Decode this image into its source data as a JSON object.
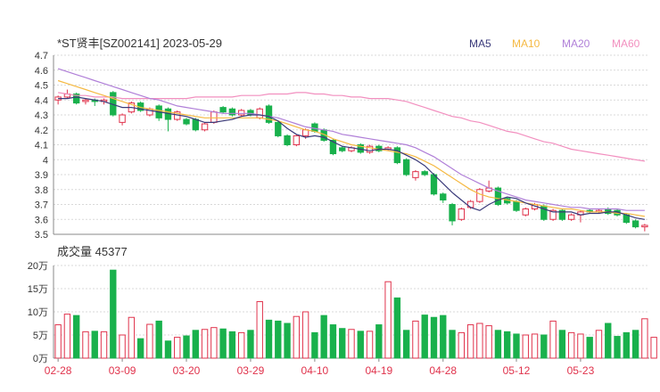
{
  "header": {
    "title": "*ST贤丰[SZ002141] 2023-05-29",
    "legend": [
      {
        "label": "MA5",
        "color": "#3a3a7a"
      },
      {
        "label": "MA10",
        "color": "#f5b942"
      },
      {
        "label": "MA20",
        "color": "#b07fd8"
      },
      {
        "label": "MA60",
        "color": "#f28fbf"
      }
    ]
  },
  "colors": {
    "up": "#e0334c",
    "down": "#19b14c",
    "grid": "#d9d9d9",
    "axis": "#333333"
  },
  "chart_data": [
    {
      "type": "candlestick",
      "ylim": [
        3.5,
        4.7
      ],
      "yticks": [
        "3.5",
        "3.6",
        "3.7",
        "3.8",
        "3.9",
        "4",
        "4.1",
        "4.2",
        "4.3",
        "4.4",
        "4.5",
        "4.6",
        "4.7"
      ],
      "candles": [
        [
          4.4,
          4.42,
          4.43,
          4.37
        ],
        [
          4.42,
          4.44,
          4.47,
          4.41
        ],
        [
          4.44,
          4.38,
          4.45,
          4.37
        ],
        [
          4.39,
          4.4,
          4.41,
          4.37
        ],
        [
          4.4,
          4.39,
          4.41,
          4.36
        ],
        [
          4.39,
          4.4,
          4.41,
          4.37
        ],
        [
          4.45,
          4.3,
          4.46,
          4.29
        ],
        [
          4.25,
          4.3,
          4.31,
          4.23
        ],
        [
          4.32,
          4.38,
          4.39,
          4.31
        ],
        [
          4.38,
          4.33,
          4.39,
          4.32
        ],
        [
          4.3,
          4.34,
          4.35,
          4.29
        ],
        [
          4.36,
          4.28,
          4.37,
          4.26
        ],
        [
          4.34,
          4.27,
          4.35,
          4.19
        ],
        [
          4.27,
          4.32,
          4.33,
          4.26
        ],
        [
          4.27,
          4.24,
          4.28,
          4.23
        ],
        [
          4.27,
          4.2,
          4.28,
          4.19
        ],
        [
          4.2,
          4.24,
          4.25,
          4.19
        ],
        [
          4.25,
          4.32,
          4.33,
          4.24
        ],
        [
          4.35,
          4.32,
          4.36,
          4.31
        ],
        [
          4.34,
          4.3,
          4.35,
          4.29
        ],
        [
          4.3,
          4.33,
          4.34,
          4.29
        ],
        [
          4.33,
          4.3,
          4.34,
          4.29
        ],
        [
          4.28,
          4.34,
          4.35,
          4.27
        ],
        [
          4.36,
          4.25,
          4.37,
          4.24
        ],
        [
          4.25,
          4.16,
          4.26,
          4.15
        ],
        [
          4.16,
          4.1,
          4.17,
          4.09
        ],
        [
          4.1,
          4.16,
          4.17,
          4.09
        ],
        [
          4.16,
          4.2,
          4.21,
          4.14
        ],
        [
          4.24,
          4.19,
          4.25,
          4.18
        ],
        [
          4.2,
          4.13,
          4.21,
          4.12
        ],
        [
          4.13,
          4.04,
          4.14,
          4.03
        ],
        [
          4.08,
          4.06,
          4.09,
          4.05
        ],
        [
          4.06,
          4.08,
          4.09,
          4.05
        ],
        [
          4.1,
          4.05,
          4.11,
          4.04
        ],
        [
          4.05,
          4.09,
          4.1,
          4.04
        ],
        [
          4.09,
          4.06,
          4.1,
          4.05
        ],
        [
          4.07,
          4.08,
          4.09,
          4.06
        ],
        [
          4.08,
          3.98,
          4.09,
          3.97
        ],
        [
          4.0,
          3.9,
          4.01,
          3.89
        ],
        [
          3.88,
          3.92,
          3.93,
          3.86
        ],
        [
          3.92,
          3.9,
          3.93,
          3.89
        ],
        [
          3.9,
          3.77,
          3.91,
          3.76
        ],
        [
          3.77,
          3.73,
          3.78,
          3.71
        ],
        [
          3.7,
          3.59,
          3.71,
          3.56
        ],
        [
          3.6,
          3.67,
          3.68,
          3.59
        ],
        [
          3.68,
          3.72,
          3.73,
          3.67
        ],
        [
          3.72,
          3.8,
          3.81,
          3.71
        ],
        [
          3.79,
          3.81,
          3.86,
          3.78
        ],
        [
          3.81,
          3.7,
          3.82,
          3.69
        ],
        [
          3.74,
          3.71,
          3.75,
          3.7
        ],
        [
          3.72,
          3.66,
          3.73,
          3.65
        ],
        [
          3.63,
          3.67,
          3.68,
          3.62
        ],
        [
          3.67,
          3.7,
          3.71,
          3.66
        ],
        [
          3.69,
          3.6,
          3.7,
          3.59
        ],
        [
          3.6,
          3.66,
          3.67,
          3.59
        ],
        [
          3.66,
          3.6,
          3.67,
          3.59
        ],
        [
          3.6,
          3.63,
          3.64,
          3.59
        ],
        [
          3.63,
          3.65,
          3.66,
          3.58
        ],
        [
          3.66,
          3.65,
          3.67,
          3.64
        ],
        [
          3.65,
          3.66,
          3.67,
          3.64
        ],
        [
          3.67,
          3.64,
          3.68,
          3.63
        ],
        [
          3.66,
          3.63,
          3.67,
          3.62
        ],
        [
          3.63,
          3.58,
          3.64,
          3.57
        ],
        [
          3.59,
          3.55,
          3.6,
          3.54
        ],
        [
          3.55,
          3.56,
          3.57,
          3.52
        ]
      ],
      "ma5": [
        4.41,
        4.41,
        4.42,
        4.41,
        4.4,
        4.39,
        4.37,
        4.35,
        4.35,
        4.34,
        4.33,
        4.32,
        4.31,
        4.3,
        4.29,
        4.27,
        4.25,
        4.25,
        4.26,
        4.27,
        4.29,
        4.3,
        4.3,
        4.29,
        4.26,
        4.21,
        4.17,
        4.15,
        4.16,
        4.15,
        4.12,
        4.09,
        4.08,
        4.07,
        4.06,
        4.07,
        4.07,
        4.06,
        4.03,
        4.0,
        3.96,
        3.9,
        3.84,
        3.78,
        3.73,
        3.68,
        3.66,
        3.7,
        3.73,
        3.75,
        3.74,
        3.71,
        3.69,
        3.67,
        3.65,
        3.65,
        3.65,
        3.63,
        3.64,
        3.64,
        3.65,
        3.65,
        3.63,
        3.61,
        3.6
      ],
      "ma10": [
        4.53,
        4.51,
        4.49,
        4.47,
        4.45,
        4.43,
        4.41,
        4.39,
        4.37,
        4.35,
        4.34,
        4.33,
        4.32,
        4.31,
        4.3,
        4.29,
        4.28,
        4.28,
        4.28,
        4.28,
        4.28,
        4.28,
        4.28,
        4.27,
        4.26,
        4.24,
        4.22,
        4.2,
        4.19,
        4.17,
        4.14,
        4.12,
        4.1,
        4.09,
        4.08,
        4.07,
        4.06,
        4.05,
        4.04,
        4.02,
        3.99,
        3.96,
        3.92,
        3.88,
        3.84,
        3.8,
        3.77,
        3.75,
        3.74,
        3.73,
        3.72,
        3.71,
        3.7,
        3.69,
        3.68,
        3.67,
        3.67,
        3.66,
        3.65,
        3.65,
        3.65,
        3.64,
        3.64,
        3.63,
        3.62
      ],
      "ma20": [
        4.61,
        4.59,
        4.57,
        4.55,
        4.53,
        4.51,
        4.49,
        4.47,
        4.45,
        4.43,
        4.41,
        4.4,
        4.38,
        4.36,
        4.35,
        4.34,
        4.33,
        4.32,
        4.31,
        4.31,
        4.31,
        4.31,
        4.3,
        4.29,
        4.28,
        4.26,
        4.24,
        4.22,
        4.21,
        4.2,
        4.19,
        4.17,
        4.16,
        4.15,
        4.14,
        4.13,
        4.12,
        4.11,
        4.1,
        4.08,
        4.05,
        4.02,
        3.98,
        3.94,
        3.9,
        3.87,
        3.84,
        3.81,
        3.79,
        3.77,
        3.75,
        3.73,
        3.72,
        3.71,
        3.7,
        3.69,
        3.68,
        3.68,
        3.67,
        3.67,
        3.67,
        3.67,
        3.66,
        3.66,
        3.66
      ],
      "ma60": [
        4.45,
        4.44,
        4.43,
        4.43,
        4.42,
        4.42,
        4.42,
        4.41,
        4.41,
        4.41,
        4.41,
        4.41,
        4.41,
        4.41,
        4.41,
        4.42,
        4.42,
        4.42,
        4.42,
        4.42,
        4.43,
        4.43,
        4.43,
        4.44,
        4.44,
        4.44,
        4.45,
        4.45,
        4.44,
        4.44,
        4.43,
        4.43,
        4.42,
        4.42,
        4.41,
        4.41,
        4.41,
        4.4,
        4.39,
        4.37,
        4.35,
        4.33,
        4.31,
        4.29,
        4.28,
        4.26,
        4.25,
        4.23,
        4.21,
        4.19,
        4.18,
        4.16,
        4.14,
        4.12,
        4.11,
        4.09,
        4.07,
        4.06,
        4.05,
        4.04,
        4.03,
        4.02,
        4.01,
        4.0,
        3.99
      ]
    },
    {
      "type": "bar",
      "title": "成交量 45377",
      "ylim": [
        0,
        200000
      ],
      "yticks": [
        "0万",
        "5万",
        "10万",
        "15万",
        "20万"
      ],
      "volumes": [
        72000,
        95000,
        92000,
        57000,
        58000,
        57000,
        190000,
        50000,
        88000,
        42000,
        73000,
        80000,
        37000,
        45000,
        48000,
        60000,
        62000,
        66000,
        63000,
        57000,
        55000,
        60000,
        122000,
        82000,
        80000,
        75000,
        90000,
        100000,
        55000,
        92000,
        72000,
        64000,
        62000,
        58000,
        58000,
        72000,
        165000,
        130000,
        60000,
        80000,
        93000,
        88000,
        92000,
        60000,
        55000,
        72000,
        75000,
        70000,
        60000,
        57000,
        52000,
        50000,
        52000,
        50000,
        80000,
        60000,
        55000,
        52000,
        45000,
        60000,
        75000,
        47000,
        55000,
        60000,
        85000,
        45000
      ],
      "xlabels": [
        {
          "label": "02-28",
          "index": 0
        },
        {
          "label": "03-09",
          "index": 7
        },
        {
          "label": "03-20",
          "index": 14
        },
        {
          "label": "03-29",
          "index": 21
        },
        {
          "label": "04-10",
          "index": 28
        },
        {
          "label": "04-19",
          "index": 35
        },
        {
          "label": "04-28",
          "index": 42
        },
        {
          "label": "05-12",
          "index": 50
        },
        {
          "label": "05-23",
          "index": 57
        }
      ]
    }
  ]
}
